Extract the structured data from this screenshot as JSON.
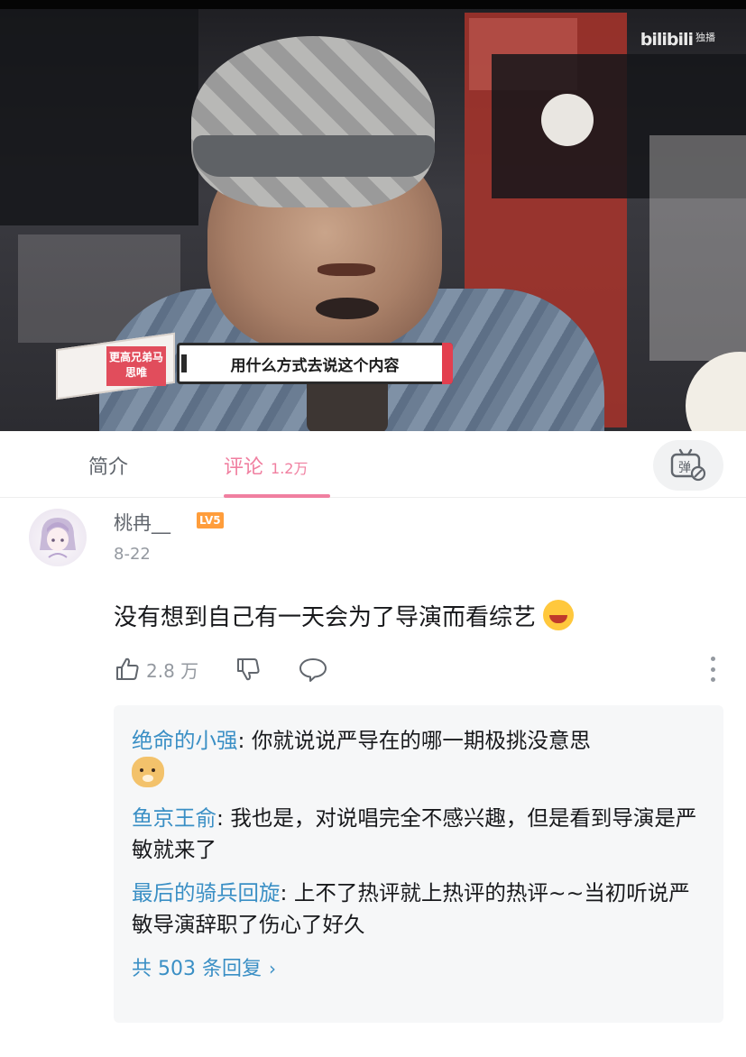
{
  "video": {
    "logo": "bilibili",
    "logo_sub": "独播",
    "badge": "更高兄弟马思唯",
    "subtitle": "用什么方式去说这个内容"
  },
  "tabs": {
    "intro_label": "简介",
    "comments_label": "评论",
    "comments_count": "1.2万",
    "danmaku_icon": "danmaku-toggle-icon"
  },
  "comment": {
    "username": "桃冉__",
    "level": "LV5",
    "date": "8-22",
    "text": "没有想到自己有一天会为了导演而看综艺",
    "emoji": "laughing-crying-emoji",
    "like_count": "2.8 万"
  },
  "replies": {
    "items": [
      {
        "name": "绝命的小强",
        "sep": ": ",
        "text": "你就说说严导在的哪一期极挑没意思",
        "emoji": "doge-emoji"
      },
      {
        "name": "鱼京王俞",
        "sep": ": ",
        "text": "我也是，对说唱完全不感兴趣，但是看到导演是严敏就来了"
      },
      {
        "name": "最后的骑兵回旋",
        "sep": ": ",
        "text": "上不了热评就上热评的热评~~当初听说严敏导演辞职了伤心了好久"
      }
    ],
    "more_label": "共 503 条回复"
  },
  "colors": {
    "accent_pink": "#f07fa0",
    "reply_blue": "#3a8fc5",
    "level_orange": "#ff9d3b"
  }
}
